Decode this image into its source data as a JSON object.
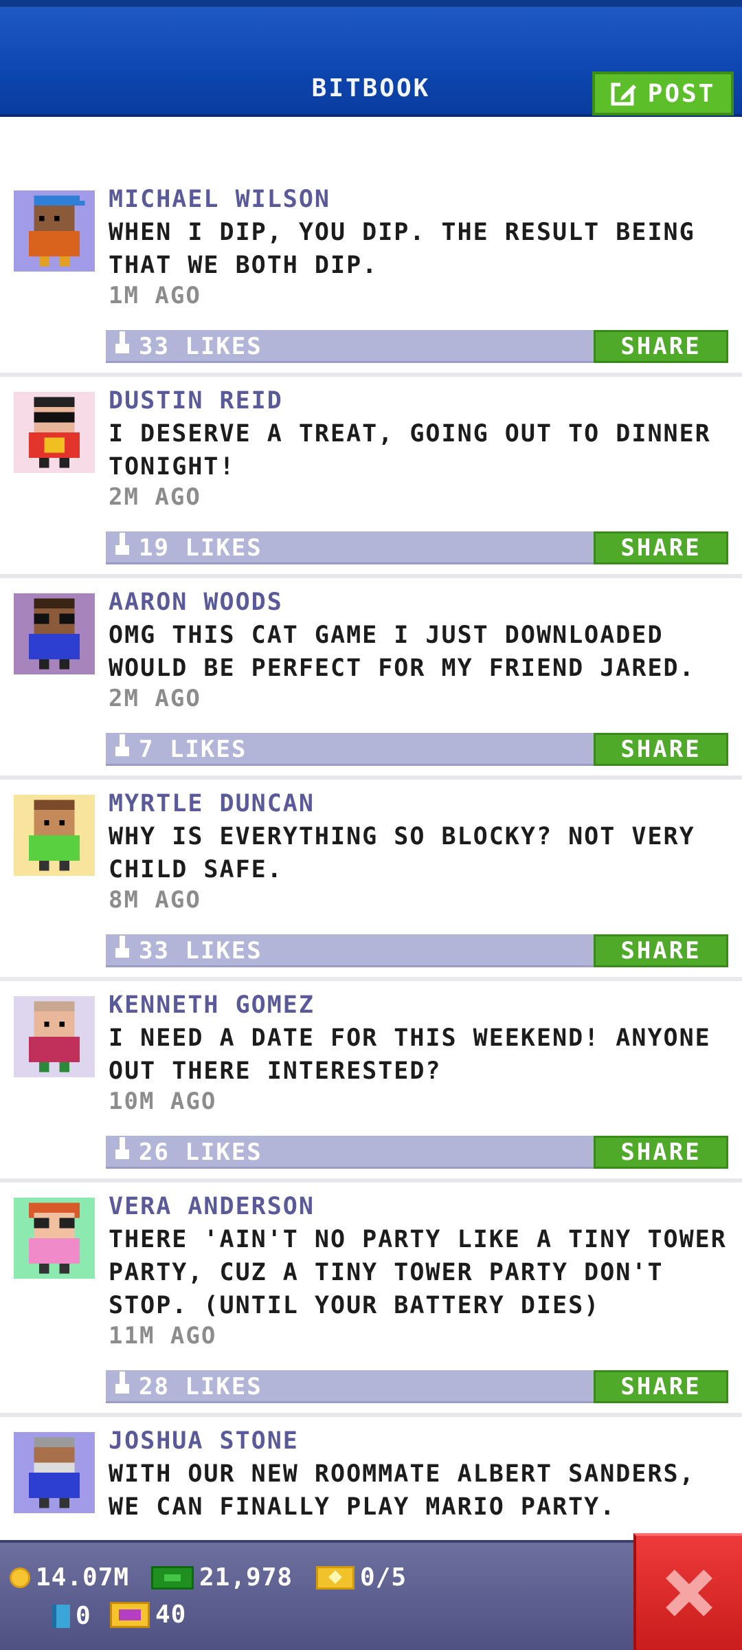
{
  "header": {
    "title": "BITBOOK",
    "post_label": "POST"
  },
  "posts": [
    {
      "name": "MICHAEL WILSON",
      "message": "WHEN I DIP, YOU DIP. THE RESULT BEING\nTHAT WE BOTH DIP.",
      "time": "1M AGO",
      "likes": "33 LIKES",
      "share": "SHARE"
    },
    {
      "name": "DUSTIN REID",
      "message": "I DESERVE A TREAT, GOING OUT TO DINNER\nTONIGHT!",
      "time": "2M AGO",
      "likes": "19 LIKES",
      "share": "SHARE"
    },
    {
      "name": "AARON WOODS",
      "message": "OMG THIS CAT GAME I JUST DOWNLOADED\nWOULD BE PERFECT FOR MY FRIEND JARED.",
      "time": "2M AGO",
      "likes": "7 LIKES",
      "share": "SHARE"
    },
    {
      "name": "MYRTLE DUNCAN",
      "message": "WHY IS EVERYTHING SO BLOCKY? NOT VERY\nCHILD SAFE.",
      "time": "8M AGO",
      "likes": "33 LIKES",
      "share": "SHARE"
    },
    {
      "name": "KENNETH GOMEZ",
      "message": "I NEED A DATE FOR THIS WEEKEND! ANYONE\nOUT THERE INTERESTED?",
      "time": "10M AGO",
      "likes": "26 LIKES",
      "share": "SHARE"
    },
    {
      "name": "VERA ANDERSON",
      "message": "THERE 'AIN'T NO PARTY LIKE A TINY TOWER\nPARTY, CUZ A TINY TOWER PARTY DON'T\nSTOP. (UNTIL YOUR BATTERY DIES)",
      "time": "11M AGO",
      "likes": "28 LIKES",
      "share": "SHARE"
    },
    {
      "name": "JOSHUA STONE",
      "message": "WITH OUR NEW ROOMMATE ALBERT SANDERS,\nWE CAN FINALLY PLAY MARIO PARTY.",
      "time": "",
      "likes": "",
      "share": ""
    }
  ],
  "resources": {
    "coins": "14.07M",
    "bux": "21,978",
    "tickets": "0/5",
    "cylinders": "0",
    "vip": "40"
  },
  "colors": {
    "header_blue": "#0d46b0",
    "accent_green": "#4faa2a",
    "likes_bar": "#b2b4d8",
    "name_purple": "#5a5a9a",
    "close_red": "#d42626"
  }
}
